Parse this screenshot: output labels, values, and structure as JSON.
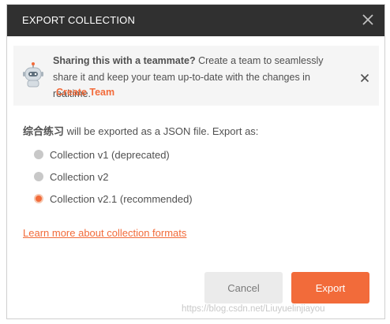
{
  "header": {
    "title": "EXPORT COLLECTION",
    "close_icon": "close-icon"
  },
  "banner": {
    "bold_text": "Sharing this with a teammate?",
    "text": "Create a team to seamlessly share it and keep your team up-to-date with the changes in realtime.",
    "link": "Create Team",
    "icon": "robot-icon"
  },
  "intro": {
    "collection_name": "综合练习",
    "text": "will be exported as a JSON file. Export as:"
  },
  "options": [
    {
      "label": "Collection v1 (deprecated)",
      "selected": false
    },
    {
      "label": "Collection v2",
      "selected": false
    },
    {
      "label": "Collection v2.1 (recommended)",
      "selected": true
    }
  ],
  "learn_more": "Learn more about collection formats",
  "buttons": {
    "cancel": "Cancel",
    "export": "Export"
  },
  "watermark": "https://blog.csdn.net/Liuyuelinjiayou",
  "colors": {
    "accent": "#f26b3a",
    "header_bg": "#303030",
    "banner_bg": "#f5f5f5"
  }
}
